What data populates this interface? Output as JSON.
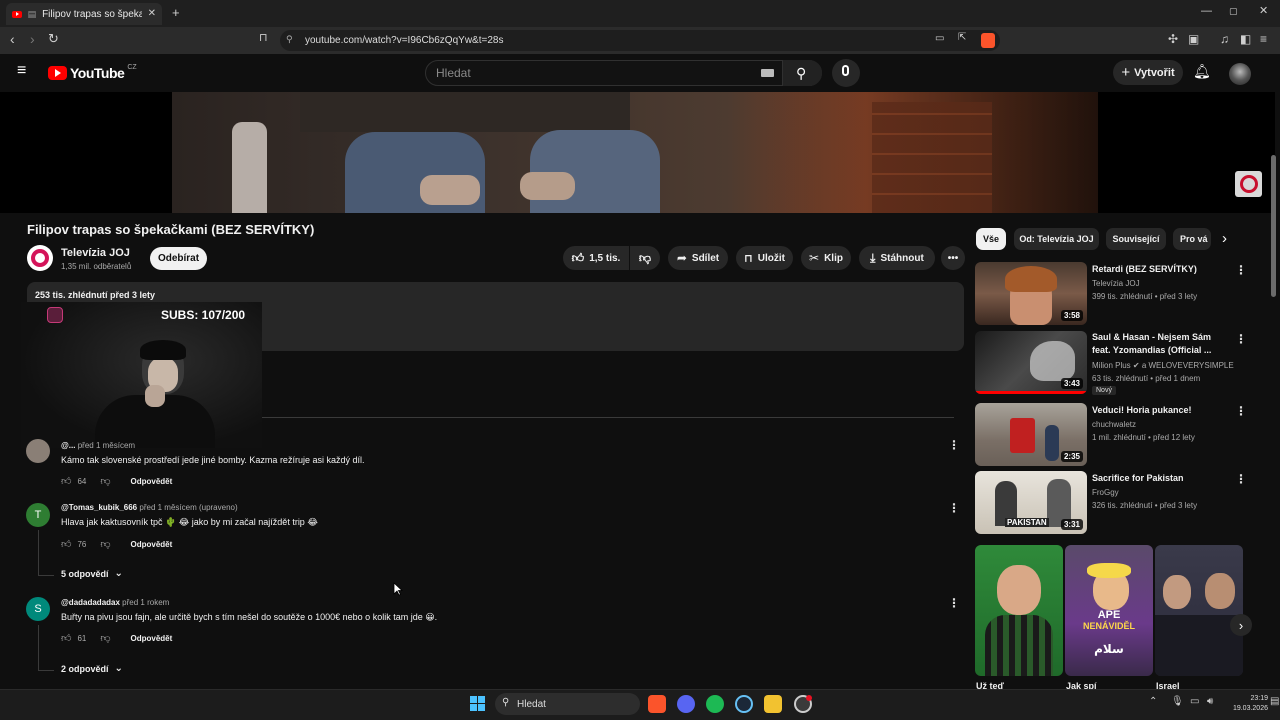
{
  "browser": {
    "tab_title": "Filipov trapas so špekačkami",
    "url": "youtube.com/watch?v=I96Cb6zQqYw&t=28s"
  },
  "youtube": {
    "logo_text": "YouTube",
    "region": "CZ",
    "search_placeholder": "Hledat",
    "create_label": "Vytvořit"
  },
  "video": {
    "title": "Filipov trapas so špekačkami (BEZ SERVÍTKY)",
    "channel": "Televízia JOJ",
    "subscribers": "1,35 mil. odběratelů",
    "subscribe_label": "Odebírat",
    "likes": "1,5 tis.",
    "share_label": "Sdílet",
    "save_label": "Uložit",
    "clip_label": "Klip",
    "download_label": "Stáhnout",
    "stats": "253 tis. zhlédnutí  před 3 lety"
  },
  "overlay": {
    "subs_counter": "SUBS: 107/200"
  },
  "comments": [
    {
      "author": "@...",
      "time": "před 1 měsícem",
      "text": "Kámo tak slovenské prostředí jede jiné bomby. Kazma režíruje asi každý díl.",
      "likes": "64",
      "reply_label": "Odpovědět",
      "avatar_letter": "",
      "avatar_color": "#8a7f76"
    },
    {
      "author": "@Tomas_kubik_666",
      "time": "před 1 měsícem (upraveno)",
      "text": "Hlava jak kaktusovník tpč 🌵 😂 jako by mi začal najíždět trip 😂",
      "likes": "76",
      "reply_label": "Odpovědět",
      "avatar_letter": "T",
      "avatar_color": "#2e7d32",
      "replies": "5 odpovědí"
    },
    {
      "author": "@dadadadadax",
      "time": "před 1 rokem",
      "text": "Buřty na pivu jsou fajn, ale určitě bych s tím nešel do soutěže o 1000€ nebo o kolik tam jde 😀.",
      "likes": "61",
      "reply_label": "Odpovědět",
      "avatar_letter": "S",
      "avatar_color": "#00897b",
      "replies": "2 odpovědí"
    }
  ],
  "sidebar": {
    "chips": [
      "Vše",
      "Od: Televízia JOJ",
      "Související",
      "Pro vá"
    ],
    "videos": [
      {
        "title": "Retardi (BEZ SERVÍTKY)",
        "channel": "Televízia JOJ",
        "meta": "399 tis. zhlédnutí • před 3 lety",
        "duration": "3:58"
      },
      {
        "title": "Saul & Hasan - Nejsem Sám feat. Yzomandias (Official ...",
        "channel": "Milion Plus ✔ a WELOVEVERYSIMPLE",
        "meta": "63 tis. zhlédnutí • před 1 dnem",
        "duration": "3:43",
        "badge": "Nový"
      },
      {
        "title": "Veduci! Horia pukance!",
        "channel": "chuchwaletz",
        "meta": "1 mil. zhlédnutí • před 12 lety",
        "duration": "2:35"
      },
      {
        "title": "Sacrifice for Pakistan",
        "channel": "FroGgy",
        "meta": "326 tis. zhlédnutí • před 3 lety",
        "duration": "3:31",
        "thumb_text": "PAKISTAN"
      }
    ],
    "shorts": [
      {
        "label": "Už teď"
      },
      {
        "label": "Jak spí",
        "overlay_top": "APE",
        "overlay_bottom": "NENÁVIDĚL",
        "overlay_arabic": "سلام"
      },
      {
        "label": "Israel"
      }
    ]
  },
  "taskbar": {
    "search_label": "Hledat",
    "time": "23:19",
    "date": "19.03.2026"
  }
}
